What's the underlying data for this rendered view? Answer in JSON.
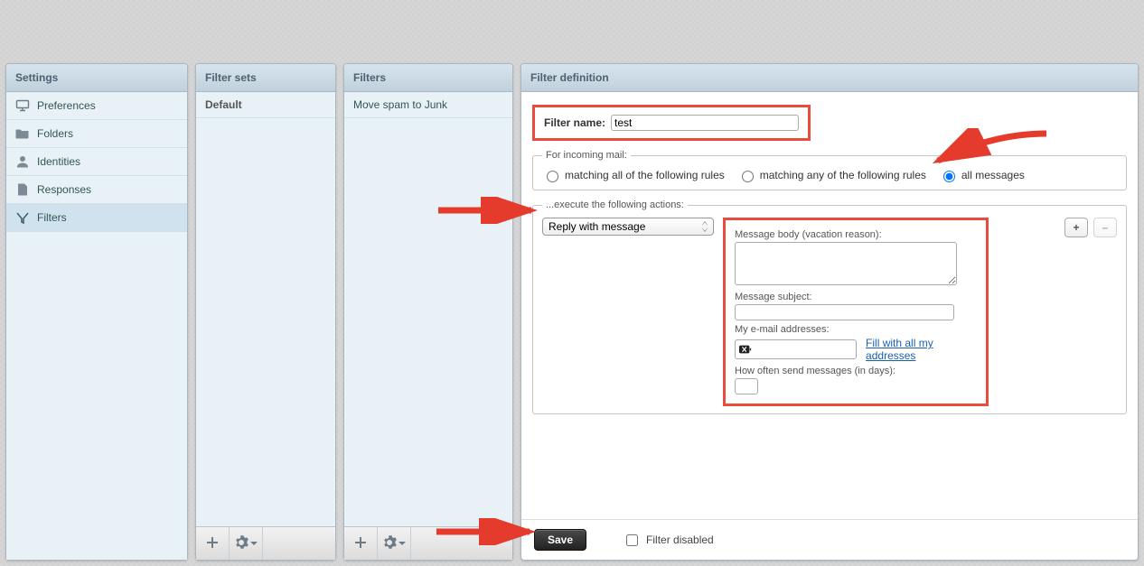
{
  "colors": {
    "highlight": "#e74c3c",
    "link": "#1b5fae"
  },
  "settings": {
    "header": "Settings",
    "items": [
      {
        "label": "Preferences",
        "icon": "monitor-icon"
      },
      {
        "label": "Folders",
        "icon": "folder-icon"
      },
      {
        "label": "Identities",
        "icon": "person-icon"
      },
      {
        "label": "Responses",
        "icon": "page-icon"
      },
      {
        "label": "Filters",
        "icon": "filter-icon",
        "selected": true
      }
    ]
  },
  "filtersets": {
    "header": "Filter sets",
    "items": [
      {
        "label": "Default",
        "bold": true
      }
    ],
    "toolbar": {
      "add": "+",
      "gear": "settings"
    }
  },
  "filters": {
    "header": "Filters",
    "items": [
      {
        "label": "Move spam to Junk"
      }
    ],
    "toolbar": {
      "add": "+",
      "gear": "settings"
    }
  },
  "definition": {
    "header": "Filter definition",
    "name_label": "Filter name:",
    "name_value": "test",
    "incoming_legend": "For incoming mail:",
    "radios": {
      "all_rules": "matching all of the following rules",
      "any_rules": "matching any of the following rules",
      "all_msgs": "all messages",
      "selected": "all_msgs"
    },
    "actions_legend": "...execute the following actions:",
    "action_selected": "Reply with message",
    "vacation": {
      "body_label": "Message body (vacation reason):",
      "body_value": "",
      "subject_label": "Message subject:",
      "subject_value": "",
      "addresses_label": "My e-mail addresses:",
      "fill_link": "Fill with all my addresses",
      "days_label": "How often send messages (in days):",
      "days_value": ""
    },
    "rowbuttons": {
      "add": "+",
      "remove": "–"
    },
    "save_label": "Save",
    "disabled_label": "Filter disabled",
    "disabled_checked": false
  }
}
